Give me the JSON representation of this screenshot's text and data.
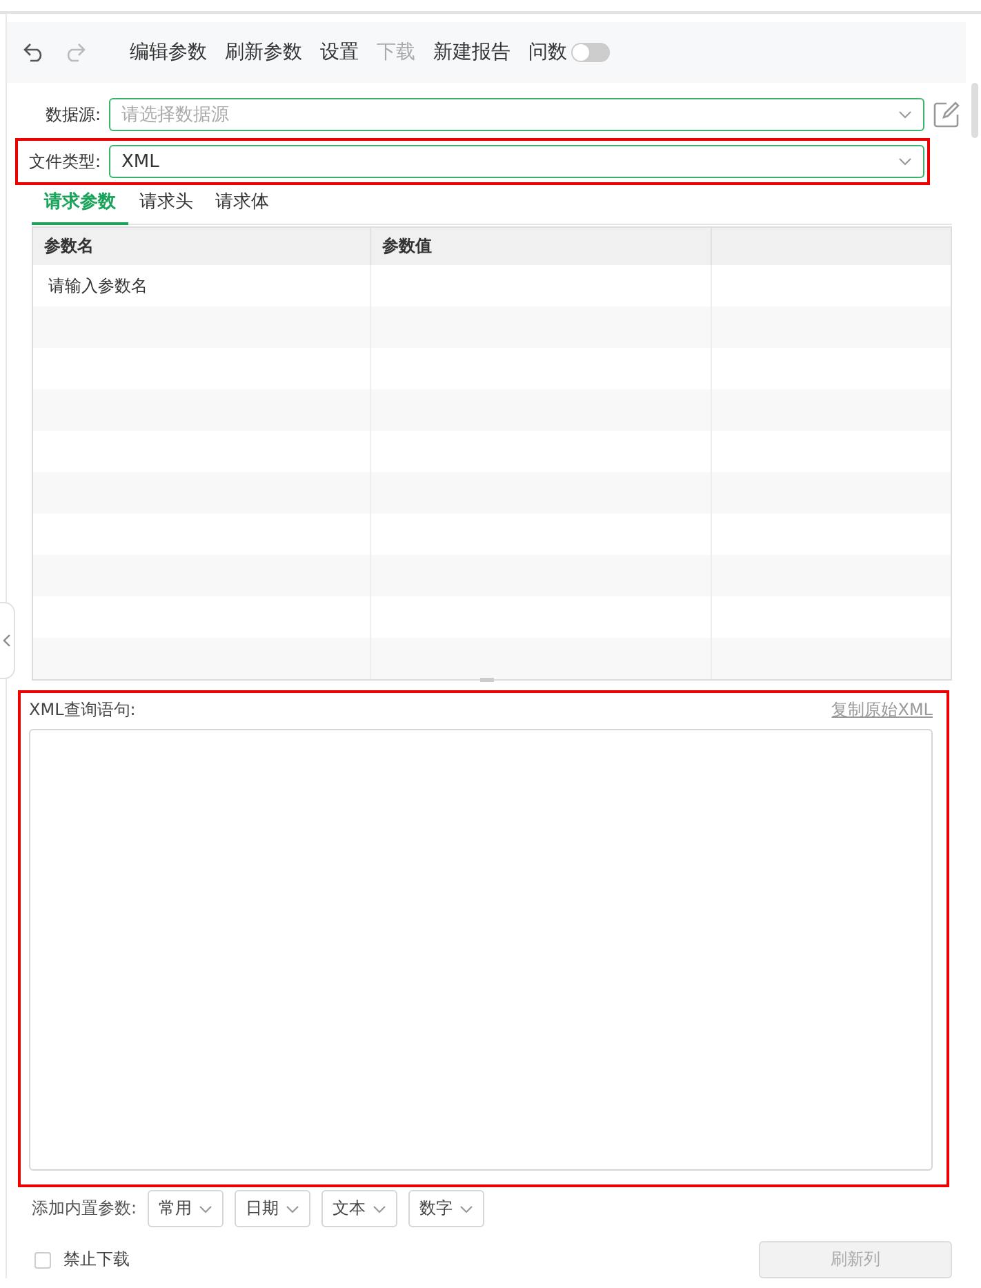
{
  "toolbar": {
    "actions": [
      {
        "label": "编辑参数",
        "disabled": false
      },
      {
        "label": "刷新参数",
        "disabled": false
      },
      {
        "label": "设置",
        "disabled": false
      },
      {
        "label": "下载",
        "disabled": true
      },
      {
        "label": "新建报告",
        "disabled": false
      }
    ],
    "toggle": {
      "label": "问数",
      "on": false
    }
  },
  "datasource": {
    "label": "数据源:",
    "placeholder": "请选择数据源"
  },
  "file_type": {
    "label": "文件类型:",
    "value": "XML",
    "highlighted": true
  },
  "tabs": [
    {
      "label": "请求参数",
      "selected": true
    },
    {
      "label": "请求头",
      "selected": false
    },
    {
      "label": "请求体",
      "selected": false
    }
  ],
  "table": {
    "columns": [
      "参数名",
      "参数值"
    ],
    "rows": [
      {
        "placeholder": "请输入参数名"
      }
    ]
  },
  "query": {
    "label": "XML查询语句:",
    "link": "复制原始XML",
    "highlighted": true
  },
  "builtin": {
    "label": "添加内置参数:",
    "menus": [
      "常用",
      "日期",
      "文本",
      "数字"
    ]
  },
  "disable_download": {
    "label": "禁止下载",
    "checked": false
  },
  "refresh_button": {
    "label": "刷新列",
    "disabled": true
  }
}
